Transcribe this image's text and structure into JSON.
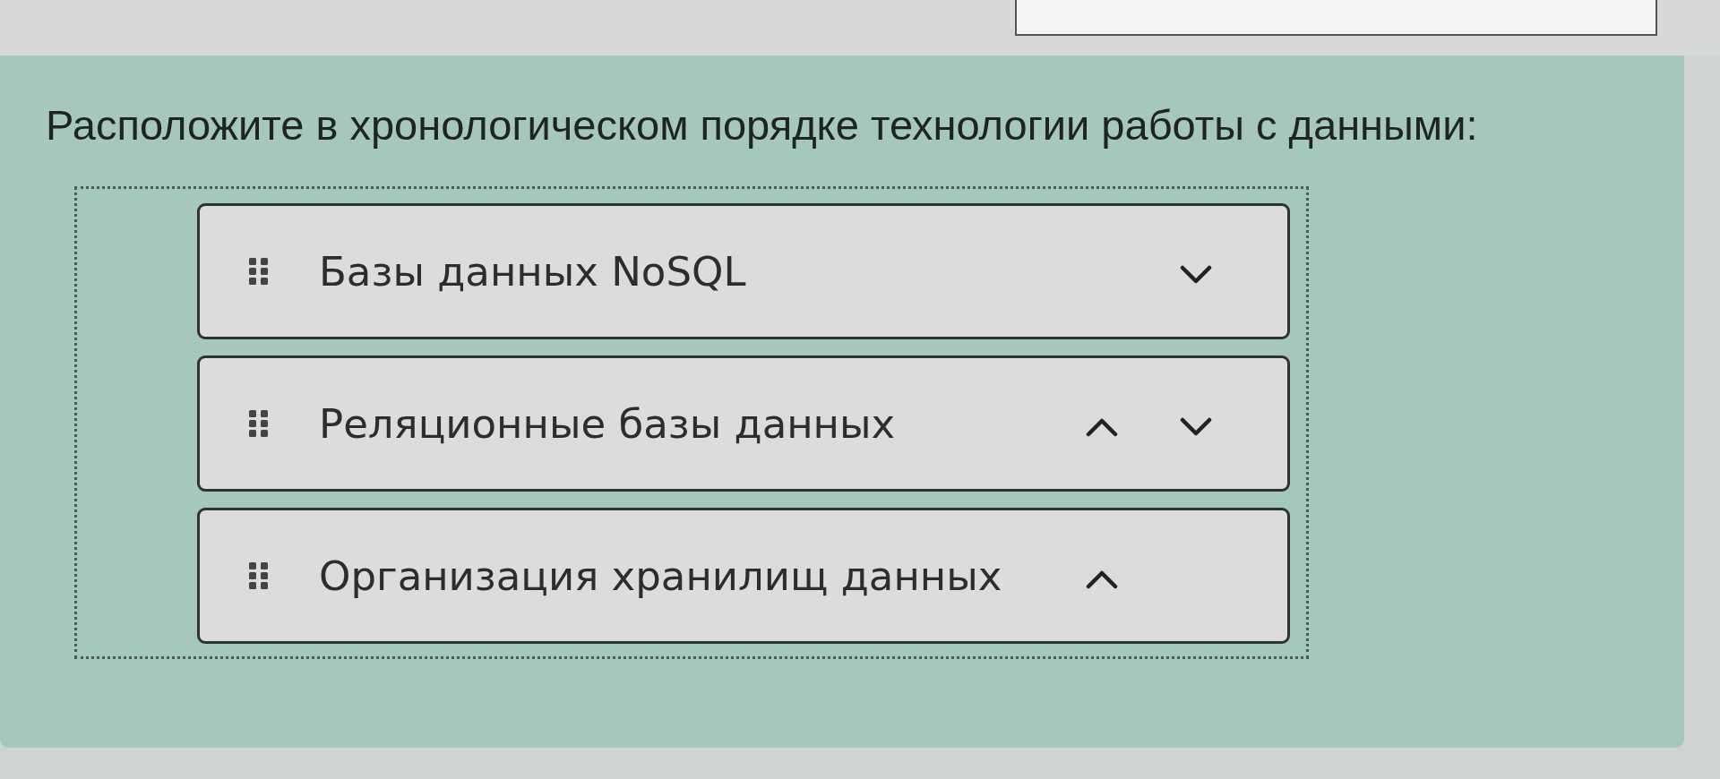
{
  "question": {
    "text": "Расположите в хронологическом порядке технологии работы с данными:"
  },
  "items": [
    {
      "label": "Базы данных NoSQL",
      "move_up": false,
      "move_down": true
    },
    {
      "label": "Реляционные базы данных",
      "move_up": true,
      "move_down": true
    },
    {
      "label": "Организация хранилищ данных",
      "move_up": true,
      "move_down": false
    }
  ]
}
